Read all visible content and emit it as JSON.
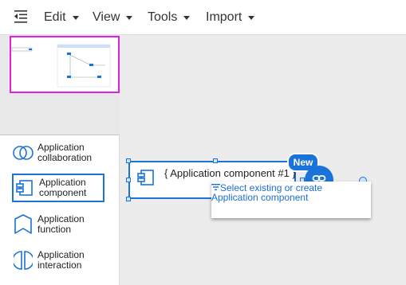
{
  "toolbar": {
    "menus": [
      "Edit",
      "View",
      "Tools",
      "Import"
    ],
    "icons": {
      "toggle": "menu-collapse-icon"
    }
  },
  "palette": {
    "items": [
      {
        "label": "Application collaboration",
        "icon": "application-collaboration-icon",
        "selected": false
      },
      {
        "label": "Application component",
        "icon": "application-component-icon",
        "selected": true
      },
      {
        "label": "Application function",
        "icon": "application-function-icon",
        "selected": false
      },
      {
        "label": "Application interaction",
        "icon": "application-interaction-icon",
        "selected": false
      }
    ]
  },
  "canvas": {
    "node": {
      "title": "{ Application component #1 }",
      "icon": "application-component-icon",
      "badge": "New"
    },
    "link_button_icon": "link-icon",
    "dropdown": {
      "text": "Select existing or create Application component",
      "icon": "filter-icon"
    }
  },
  "colors": {
    "accent": "#1a73d9",
    "overview_frame": "#e020e0",
    "canvas_bg": "#ececec"
  }
}
